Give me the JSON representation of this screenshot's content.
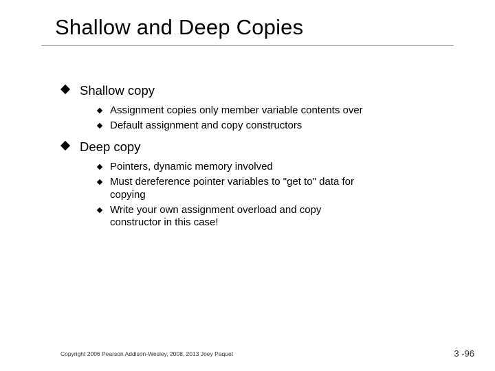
{
  "title": "Shallow and Deep Copies",
  "sections": [
    {
      "label": "Shallow copy",
      "items": [
        "Assignment copies only member variable contents over",
        "Default assignment and copy constructors"
      ]
    },
    {
      "label": "Deep copy",
      "items": [
        "Pointers, dynamic memory involved",
        "Must dereference pointer variables to \"get to\" data for copying",
        "Write your own assignment overload and copy constructor in this case!"
      ]
    }
  ],
  "footer": {
    "copyright": "Copyright 2006 Pearson Addison-Wesley, 2008, 2013 Joey Paquet",
    "page": "3 -96"
  }
}
